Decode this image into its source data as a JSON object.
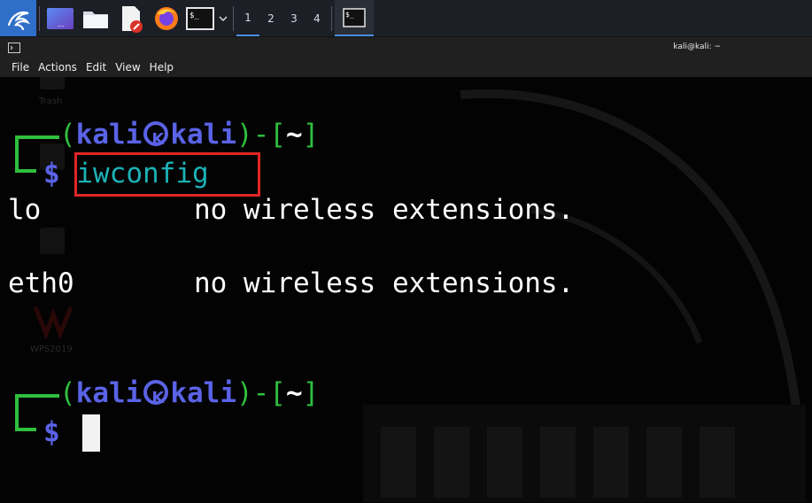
{
  "taskbar": {
    "workspaces": [
      "1",
      "2",
      "3",
      "4"
    ],
    "active_workspace": "1",
    "terminal_icon_glyph": "$_",
    "icons": [
      "kali-dragon-icon",
      "show-desktop-icon",
      "file-manager-icon",
      "text-editor-icon",
      "firefox-icon",
      "terminal-icon",
      "chevron-down-icon"
    ]
  },
  "window": {
    "title": "kali@kali: ~"
  },
  "menu": {
    "items": [
      "File",
      "Actions",
      "Edit",
      "View",
      "Help"
    ]
  },
  "desktop_ghost": {
    "trash": "Trash",
    "wps": "WPS2019"
  },
  "terminal": {
    "prompt1": {
      "open": "(",
      "user": "kali",
      "host": "kali",
      "close": ")-[",
      "dir": "~",
      "end": "]",
      "symbol": "$",
      "command": "iwconfig"
    },
    "output": [
      {
        "iface": "lo",
        "status": "no wireless extensions."
      },
      {
        "iface": "eth0",
        "status": "no wireless extensions."
      }
    ],
    "prompt2": {
      "open": "(",
      "user": "kali",
      "host": "kali",
      "close": ")-[",
      "dir": "~",
      "end": "]",
      "symbol": "$"
    }
  },
  "colors": {
    "prompt_green": "#2fbf3e",
    "prompt_blue": "#5a63e6",
    "command_cyan": "#1bb3b8",
    "highlight_red": "#e02626",
    "accent": "#4a8fe0"
  }
}
